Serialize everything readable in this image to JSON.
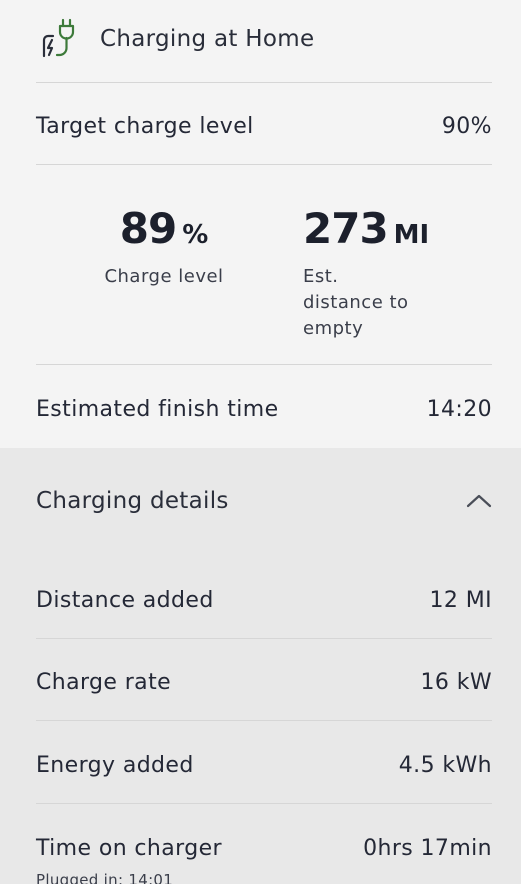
{
  "header": {
    "title": "Charging at Home",
    "icon": "plug-charging-icon",
    "icon_color": "#3d7a3a"
  },
  "target_charge": {
    "label": "Target charge level",
    "value": "90%"
  },
  "stats": {
    "charge_level": {
      "value": "89",
      "unit": "%",
      "label": "Charge level"
    },
    "distance": {
      "value": "273",
      "unit": "MI",
      "label_lines": [
        "Est.",
        "distance to",
        "empty"
      ]
    }
  },
  "finish_time": {
    "label": "Estimated finish time",
    "value": "14:20"
  },
  "details": {
    "title": "Charging details",
    "expanded": true,
    "rows": [
      {
        "label": "Distance added",
        "value": "12 MI"
      },
      {
        "label": "Charge rate",
        "value": "16 kW"
      },
      {
        "label": "Energy added",
        "value": "4.5 kWh"
      },
      {
        "label": "Time on charger",
        "value": "0hrs 17min",
        "sub": "Plugged in: 14:01"
      }
    ]
  }
}
